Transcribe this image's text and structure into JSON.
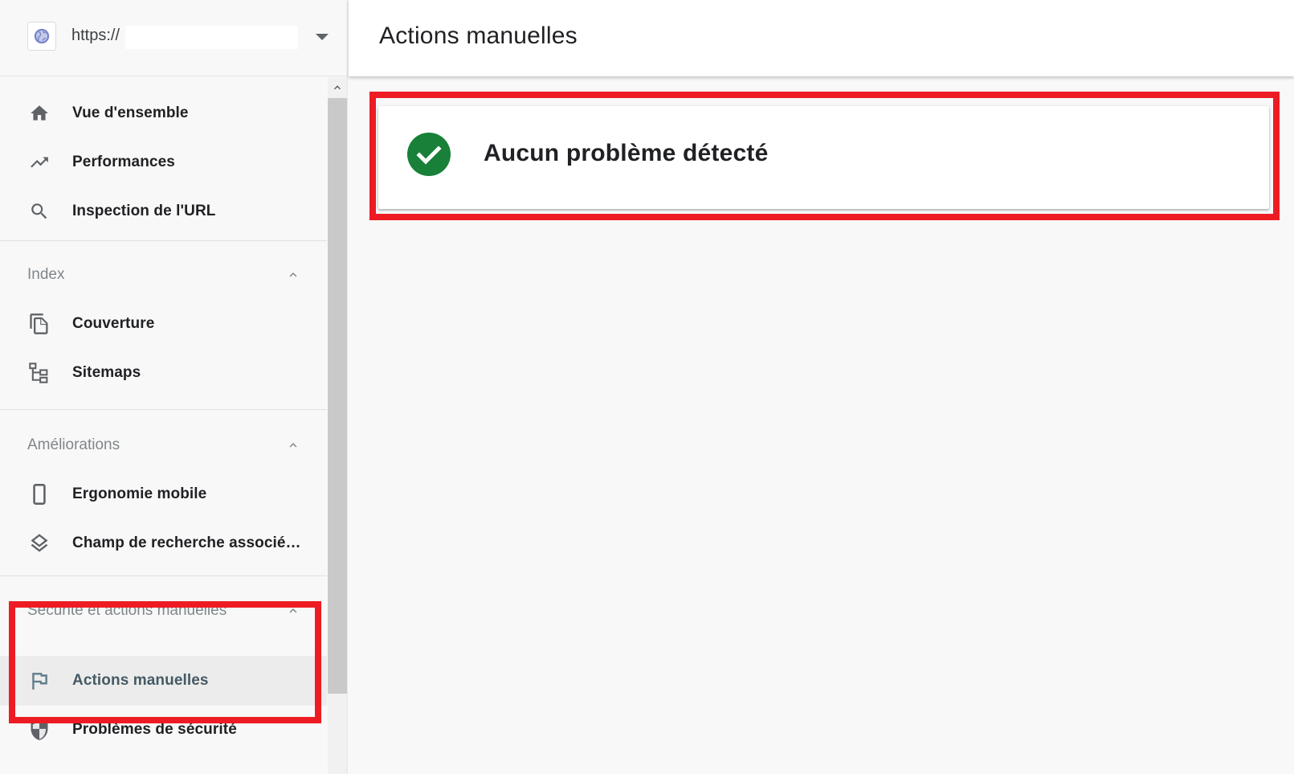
{
  "property": {
    "url_prefix": "https://",
    "icon": "globe-icon",
    "dropdown_icon": "arrow-drop-down-icon"
  },
  "sidebar": {
    "items_top": [
      {
        "label": "Vue d'ensemble",
        "icon": "home-icon"
      },
      {
        "label": "Performances",
        "icon": "trending-up-icon"
      },
      {
        "label": "Inspection de l'URL",
        "icon": "search-icon"
      }
    ],
    "sections": [
      {
        "title": "Index",
        "expanded": true,
        "items": [
          {
            "label": "Couverture",
            "icon": "file-copy-icon"
          },
          {
            "label": "Sitemaps",
            "icon": "sitemap-icon"
          }
        ]
      },
      {
        "title": "Améliorations",
        "expanded": true,
        "items": [
          {
            "label": "Ergonomie mobile",
            "icon": "smartphone-icon"
          },
          {
            "label": "Champ de recherche associé…",
            "icon": "layers-icon"
          }
        ]
      },
      {
        "title": "Sécurité et actions manuelles",
        "expanded": true,
        "items": [
          {
            "label": "Actions manuelles",
            "icon": "flag-icon",
            "selected": true
          },
          {
            "label": "Problèmes de sécurité",
            "icon": "shield-icon"
          }
        ]
      }
    ]
  },
  "main": {
    "title": "Actions manuelles",
    "status": {
      "icon": "check-circle-icon",
      "text": "Aucun problème détecté",
      "color": "#188038"
    }
  },
  "annotations": {
    "highlight_color": "#ed1c24"
  }
}
